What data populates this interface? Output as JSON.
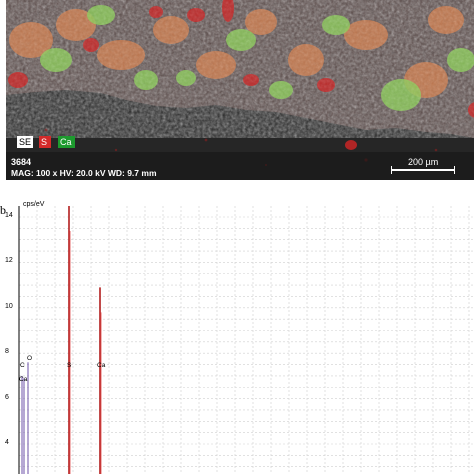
{
  "sem_map": {
    "legend": {
      "se": "SE",
      "s": "S",
      "ca": "Ca"
    },
    "sample_id": "3684",
    "acquisition": "MAG: 100 x   HV: 20.0 kV   WD: 9.7 mm",
    "scale_bar_label": "200 µm",
    "colors": {
      "s_channel": "#d32a2a",
      "ca_channel": "#1d9a2e",
      "se_channel": "#ffffff"
    }
  },
  "spectrum": {
    "panel_letter": "b",
    "y_unit": "cps/eV",
    "chart_data": {
      "type": "line",
      "ylabel": "cps/eV",
      "ylim": [
        3,
        14.5
      ],
      "y_ticks": [
        "14",
        "12",
        "10",
        "8",
        "6",
        "4"
      ],
      "grid": true,
      "peaks": [
        {
          "label": "C",
          "value": 7.0
        },
        {
          "label": "O",
          "value": 7.6
        },
        {
          "label": "Ca",
          "value": 6.9
        },
        {
          "label": "S",
          "value": 14.6
        },
        {
          "label": "Ca",
          "value": 10.9
        }
      ]
    }
  }
}
